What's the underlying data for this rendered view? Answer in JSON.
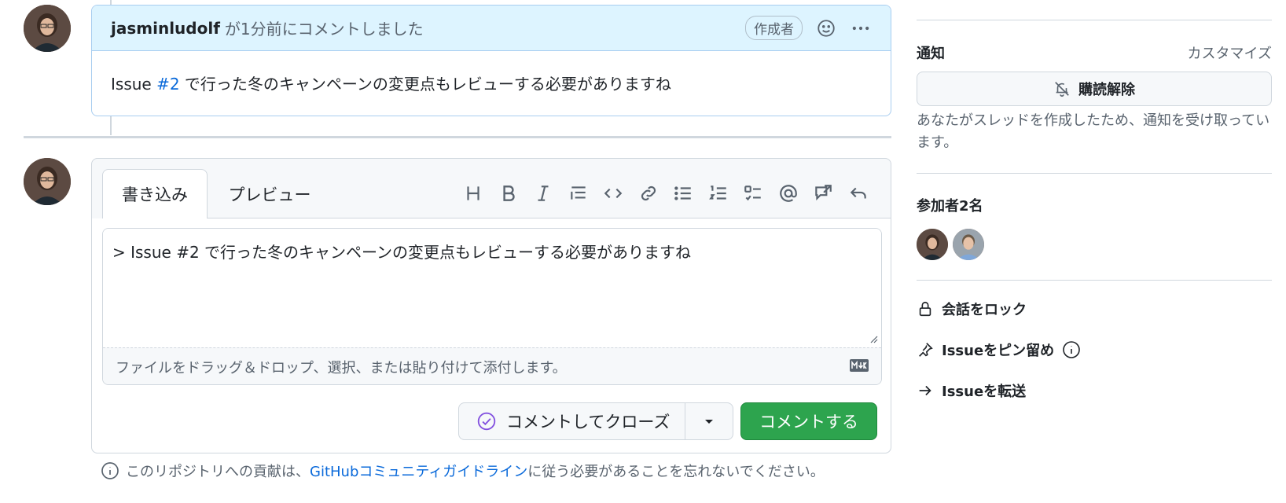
{
  "comment": {
    "author": "jasminludolf",
    "meta": "が1分前にコメントしました",
    "badge": "作成者",
    "body_prefix": "Issue",
    "body_ref": "#2",
    "body_suffix": "で行った冬のキャンペーンの変更点もレビューする必要がありますね"
  },
  "compose": {
    "tab_write": "書き込み",
    "tab_preview": "プレビュー",
    "text_value": "> Issue #2 で行った冬のキャンペーンの変更点もレビューする必要がありますね",
    "attach_hint": "ファイルをドラッグ＆ドロップ、選択、または貼り付けて添付します。",
    "close_button": "コメントしてクローズ",
    "comment_button": "コメントする"
  },
  "toolbar_icons": [
    "heading-icon",
    "bold-icon",
    "italic-icon",
    "quote-icon",
    "code-icon",
    "link-icon",
    "bullet-list-icon",
    "numbered-list-icon",
    "task-list-icon",
    "mention-icon",
    "reference-icon",
    "reply-icon"
  ],
  "guideline": {
    "prefix": "このリポジトリへの貢献は、",
    "link": "GitHubコミュニティガイドライン",
    "suffix": "に従う必要があることを忘れないでください。"
  },
  "sidebar": {
    "notifications_title": "通知",
    "customize": "カスタマイズ",
    "unsubscribe": "購読解除",
    "note": "あなたがスレッドを作成したため、通知を受け取っています。",
    "participants_title": "参加者2名",
    "lock": "会話をロック",
    "pin": "Issueをピン留め",
    "transfer": "Issueを転送"
  },
  "colors": {
    "accent_blue": "#0969da",
    "header_bg": "#ddf4ff",
    "primary_green": "#2da44e",
    "close_icon_purple": "#8250df"
  }
}
